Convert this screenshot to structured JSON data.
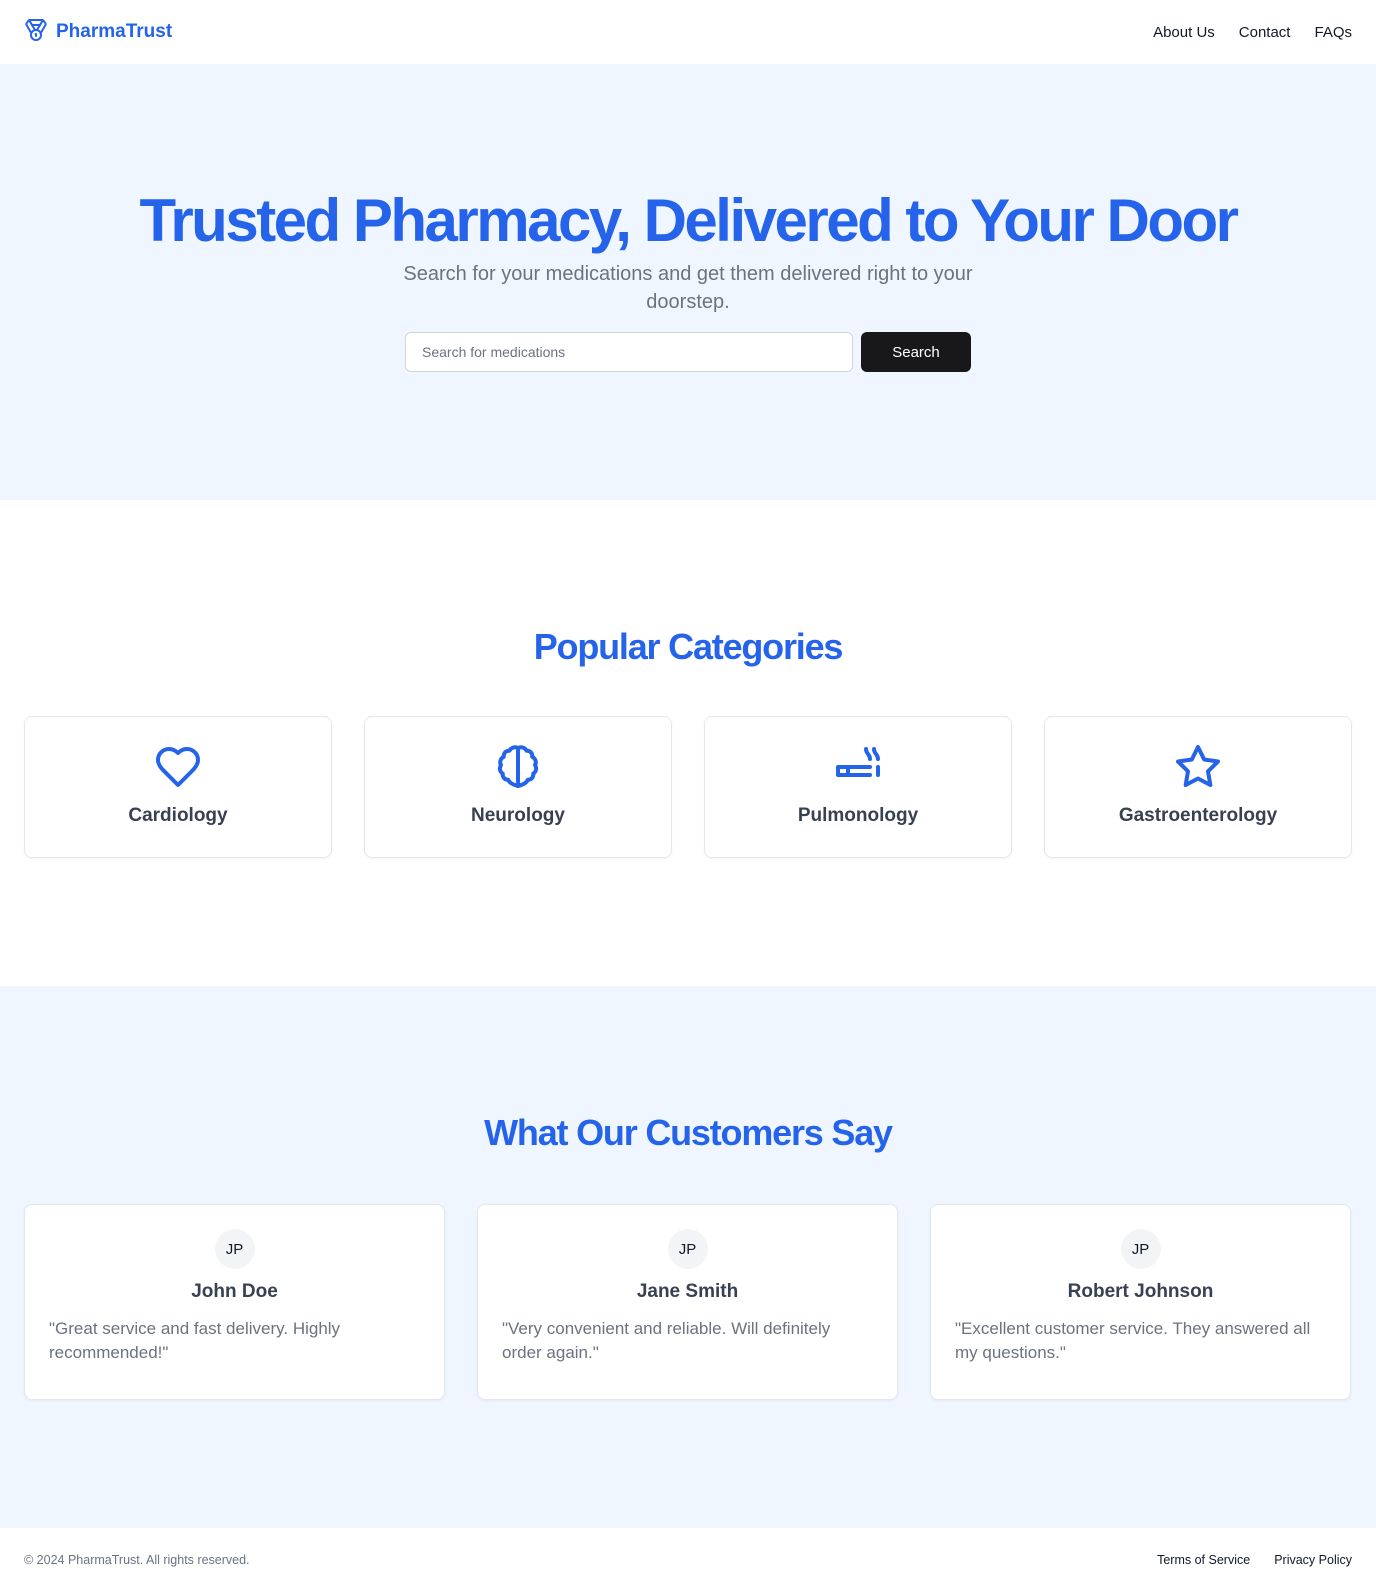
{
  "header": {
    "brand": "PharmaTrust",
    "brand_icon": "medal-icon",
    "nav": [
      {
        "label": "About Us"
      },
      {
        "label": "Contact"
      },
      {
        "label": "FAQs"
      }
    ]
  },
  "hero": {
    "title": "Trusted Pharmacy, Delivered to Your Door",
    "subtitle": "Search for your medications and get them delivered right to your doorstep.",
    "search_placeholder": "Search for medications",
    "search_value": "",
    "search_button": "Search"
  },
  "categories": {
    "title": "Popular Categories",
    "items": [
      {
        "label": "Cardiology",
        "icon": "heart-icon"
      },
      {
        "label": "Neurology",
        "icon": "brain-icon"
      },
      {
        "label": "Pulmonology",
        "icon": "cigarette-icon"
      },
      {
        "label": "Gastroenterology",
        "icon": "star-icon"
      }
    ]
  },
  "testimonials": {
    "title": "What Our Customers Say",
    "items": [
      {
        "initials": "JP",
        "name": "John Doe",
        "quote": "\"Great service and fast delivery. Highly recommended!\""
      },
      {
        "initials": "JP",
        "name": "Jane Smith",
        "quote": "\"Very convenient and reliable. Will definitely order again.\""
      },
      {
        "initials": "JP",
        "name": "Robert Johnson",
        "quote": "\"Excellent customer service. They answered all my questions.\""
      }
    ]
  },
  "footer": {
    "copyright": "© 2024 PharmaTrust. All rights reserved.",
    "links": [
      {
        "label": "Terms of Service"
      },
      {
        "label": "Privacy Policy"
      }
    ]
  },
  "colors": {
    "accent": "#2563eb",
    "hero_bg": "#eff6ff",
    "button_bg": "#18181b"
  }
}
